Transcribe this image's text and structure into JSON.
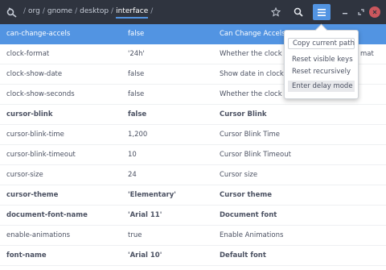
{
  "header": {
    "path_segments": [
      "/",
      "org",
      "/",
      "gnome",
      "/",
      "desktop",
      "/",
      "interface",
      "/"
    ],
    "active_segment": "interface"
  },
  "rows": [
    {
      "name": "can-change-accels",
      "value": "false",
      "desc": "Can Change Accels",
      "bold": false,
      "selected": true
    },
    {
      "name": "clock-format",
      "value": "'24h'",
      "desc": "Whether the clock di",
      "bold": false,
      "selected": false
    },
    {
      "name": "clock-show-date",
      "value": "false",
      "desc": "Show date in clock",
      "bold": false,
      "selected": false
    },
    {
      "name": "clock-show-seconds",
      "value": "false",
      "desc": "Whether the clock sh",
      "bold": false,
      "selected": false
    },
    {
      "name": "cursor-blink",
      "value": "false",
      "desc": "Cursor Blink",
      "bold": true,
      "selected": false
    },
    {
      "name": "cursor-blink-time",
      "value": "1,200",
      "desc": "Cursor Blink Time",
      "bold": false,
      "selected": false
    },
    {
      "name": "cursor-blink-timeout",
      "value": "10",
      "desc": "Cursor Blink Timeout",
      "bold": false,
      "selected": false
    },
    {
      "name": "cursor-size",
      "value": "24",
      "desc": "Cursor size",
      "bold": false,
      "selected": false
    },
    {
      "name": "cursor-theme",
      "value": "'Elementary'",
      "desc": "Cursor theme",
      "bold": true,
      "selected": false
    },
    {
      "name": "document-font-name",
      "value": "'Arial 11'",
      "desc": "Document font",
      "bold": true,
      "selected": false
    },
    {
      "name": "enable-animations",
      "value": "true",
      "desc": "Enable Animations",
      "bold": false,
      "selected": false
    },
    {
      "name": "font-name",
      "value": "'Arial 10'",
      "desc": "Default font",
      "bold": true,
      "selected": false
    }
  ],
  "row_overflow": {
    "clock-format": "mat"
  },
  "menu": {
    "copy_path": "Copy current path",
    "reset_visible": "Reset visible keys",
    "reset_recursive": "Reset recursively",
    "delay_mode": "Enter delay mode"
  },
  "colors": {
    "header_bg": "#2f343f",
    "accent": "#5294e2",
    "close": "#cc575d"
  },
  "icons": [
    "dconf-app-icon",
    "star-icon",
    "search-icon",
    "hamburger-menu-icon",
    "minimize-icon",
    "maximize-icon",
    "close-icon"
  ]
}
